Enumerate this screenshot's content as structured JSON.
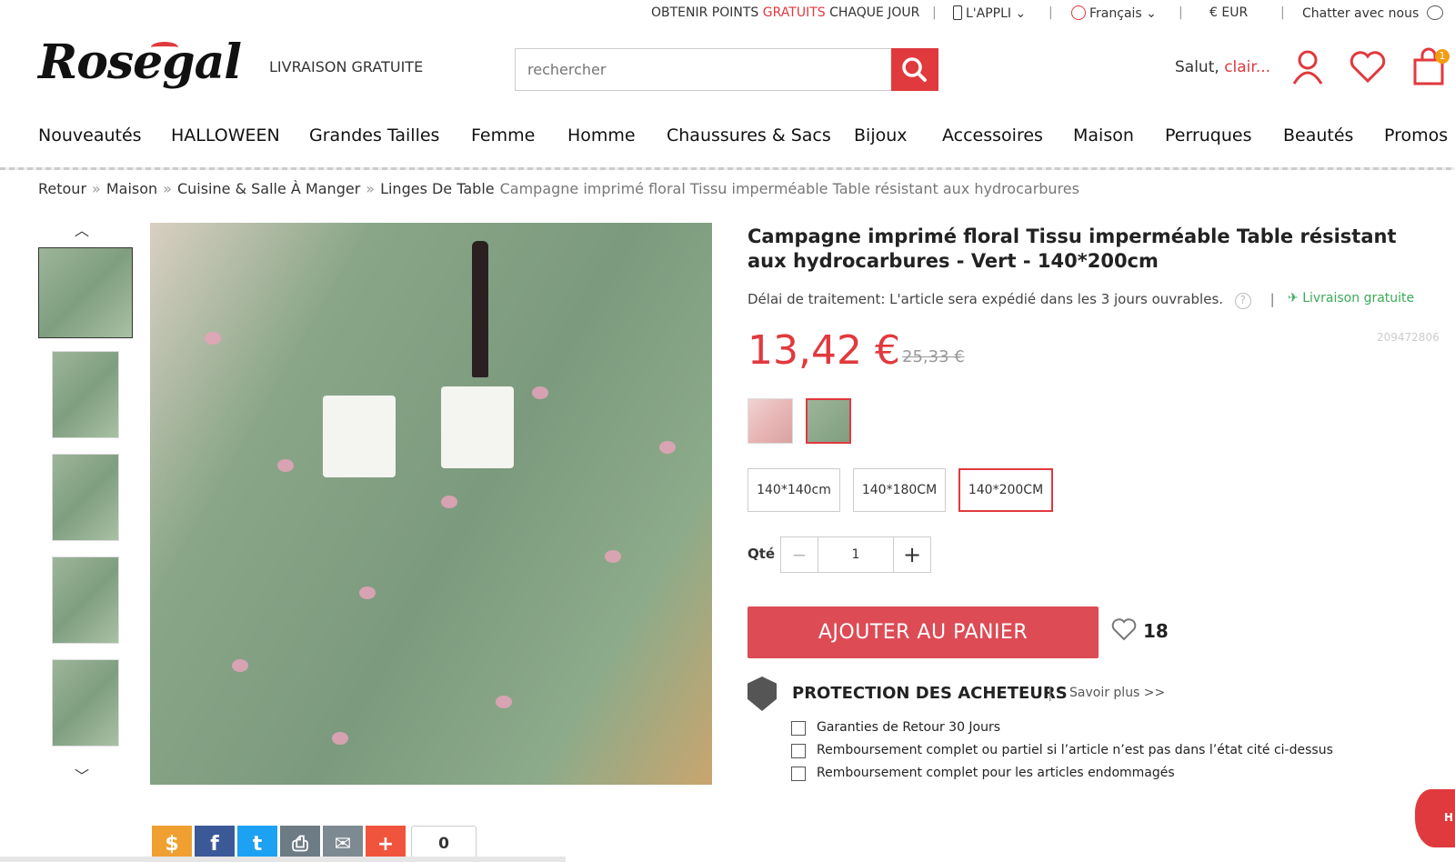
{
  "topbar": {
    "points_prefix": "OBTENIR POINTS ",
    "points_highlight": "GRATUITS",
    "points_suffix": " CHAQUE JOUR",
    "app": "L'APPLI",
    "language": "Français",
    "currency": "€ EUR",
    "chat": "Chatter avec nous"
  },
  "header": {
    "logo": "Rosegal",
    "livraison": "LIVRAISON GRATUITE",
    "search_placeholder": "rechercher",
    "salut": "Salut,",
    "user": "clair...",
    "cart_count": "1"
  },
  "nav": [
    "Nouveautés",
    "HALLOWEEN",
    "Grandes Tailles",
    "Femme",
    "Homme",
    "Chaussures & Sacs",
    "Bijoux",
    "Accessoires",
    "Maison",
    "Perruques",
    "Beautés",
    "Promos"
  ],
  "breadcrumb": {
    "items": [
      "Retour",
      "Maison",
      "Cuisine & Salle À Manger",
      "Linges De Table"
    ],
    "current": "Campagne imprimé floral Tissu imperméable Table résistant aux hydrocarbures"
  },
  "product": {
    "title": "Campagne imprimé floral Tissu imperméable Table résistant aux hydrocarbures - Vert - 140*200cm",
    "delai": "Délai de traitement: L'article sera expédié dans les 3 jours ouvrables.",
    "livraison": "Livraison gratuite",
    "sku": "209472806",
    "price": "13,42 €",
    "old_price": "25,33 €",
    "sizes": [
      "140*140cm",
      "140*180CM",
      "140*200CM"
    ],
    "qty_label": "Qté",
    "qty": "1",
    "add_to_cart": "AJOUTER AU PANIER",
    "likes": "18"
  },
  "protection": {
    "title": "PROTECTION DES ACHETEURS",
    "more": "Savoir plus >>",
    "items": [
      "Garanties de Retour 30 Jours",
      "Remboursement complet ou partiel si l’article n’est pas dans l’état cité ci-dessus",
      "Remboursement complet pour les articles endommagés"
    ]
  },
  "share": {
    "count": "0"
  },
  "colors": {
    "accent": "#e0393e",
    "cart_button": "#dd4b55",
    "free_shipping": "#3aaa57"
  },
  "icons": [
    "phone-icon",
    "globe-icon",
    "chat-icon",
    "search-icon",
    "user-icon",
    "heart-icon",
    "bag-icon",
    "help-icon",
    "plane-icon",
    "shield-icon",
    "check-icon",
    "chevron-up-icon",
    "chevron-down-icon"
  ]
}
